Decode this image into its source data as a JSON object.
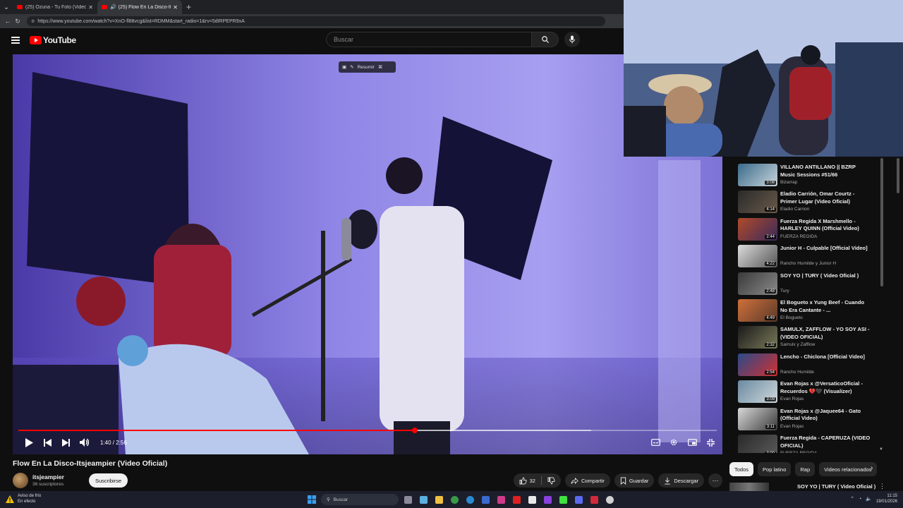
{
  "browser": {
    "tabs": [
      {
        "label": "(25) Ozuna - Tu Foto (Video Oficial)",
        "active": false
      },
      {
        "label": "(25) Flow En La Disco-Itsjeampier",
        "active": true
      }
    ],
    "url": "https://www.youtube.com/watch?v=XnO-fl88vcg&list=RDMM&start_radio=1&rv=5dIRPEPR9xA"
  },
  "youtube": {
    "logo_text": "YouTube",
    "search_placeholder": "Buscar"
  },
  "player": {
    "pip_label": "Resumir",
    "time_current": "1:40",
    "time_total": "2:56",
    "timecode": "1:40 / 2:56",
    "progress_fraction": 0.568,
    "buffered_fraction": 0.82
  },
  "video": {
    "title": "Flow En La Disco-Itsjeampier (Video Oficial)",
    "channel": "itsjeampier",
    "subscribers": "36 suscriptores",
    "subscribe_label": "Suscribirse",
    "likes": "32",
    "share_label": "Compartir",
    "save_label": "Guardar",
    "download_label": "Descargar"
  },
  "sidebar": {
    "items": [
      {
        "title": "VILLANO ANTILLANO || BZRP Music Sessions #51/66",
        "channel": "Bizarrap",
        "duration": "3:08",
        "colors": [
          "#3a6b8a",
          "#c9d4dc"
        ]
      },
      {
        "title": "Eladio Carrión, Omar Courtz - Primer Lugar (Video Oficial)",
        "channel": "Eladio Carrion",
        "duration": "4:14",
        "colors": [
          "#2a2a2a",
          "#6a5a4a"
        ]
      },
      {
        "title": "Fuerza Regida X Marshmello - HARLEY QUINN (Official Video)",
        "channel": "FUERZA REGIDA",
        "duration": "2:44",
        "colors": [
          "#b04a2a",
          "#3a2a5a"
        ]
      },
      {
        "title": "Junior H - Culpable [Official Video]",
        "channel": "Rancho Humilde y Junior H",
        "duration": "4:22",
        "colors": [
          "#dcdcdc",
          "#555555"
        ]
      },
      {
        "title": "SOY YO | TURY ( Video Oficial )",
        "channel": "Tury",
        "duration": "2:48",
        "colors": [
          "#3a3a3a",
          "#8a8a8a"
        ]
      },
      {
        "title": "El Bogueto x Yung Beef - Cuando No Era Cantante - ...",
        "channel": "El Bogueto",
        "duration": "4:49",
        "colors": [
          "#d0703a",
          "#5a3a2a"
        ]
      },
      {
        "title": "SAMULX, ZAFFLOW - YO SOY ASI - (VIDEO OFICIAL)",
        "channel": "Samulx y Zafflow",
        "duration": "2:32",
        "colors": [
          "#1a1a1a",
          "#7a7a5a"
        ]
      },
      {
        "title": "Lencho - Chiclona [Official Video]",
        "channel": "Rancho Humilde",
        "duration": "2:54",
        "colors": [
          "#2a4a8a",
          "#d03030"
        ]
      },
      {
        "title": "Evan Rojas x @VersaticoOficial - Recuerdos 💔🖤 (Visualizer)",
        "channel": "Evan Rojas",
        "duration": "3:09",
        "colors": [
          "#6a8aa0",
          "#cfd8dc"
        ]
      },
      {
        "title": "Evan Rojas x @Jaquee64 - Gato (Official Video)",
        "channel": "Evan Rojas",
        "duration": "3:11",
        "colors": [
          "#d8d8d8",
          "#3a3a3a"
        ]
      },
      {
        "title": "Fuerza Regida - CAPERUZA (VIDEO OFICIAL)",
        "channel": "FUERZA REGIDA",
        "duration": "3:00",
        "colors": [
          "#2a2a2a",
          "#5a5a5a"
        ]
      }
    ]
  },
  "chips": [
    {
      "label": "Todos",
      "active": true
    },
    {
      "label": "Pop latino",
      "active": false
    },
    {
      "label": "Rap",
      "active": false
    },
    {
      "label": "Videos relacionados",
      "active": false
    }
  ],
  "next_up": {
    "title": "SOY YO | TURY ( Video Oficial )"
  },
  "taskbar": {
    "weather_title": "Aviso de frío",
    "weather_sub": "En efecto",
    "search_label": "Buscar",
    "time": "11:15",
    "date": "19/01/2026"
  },
  "colors": {
    "accent": "#ff0000",
    "background": "#0f0f0f",
    "chip_bg": "#272727"
  }
}
